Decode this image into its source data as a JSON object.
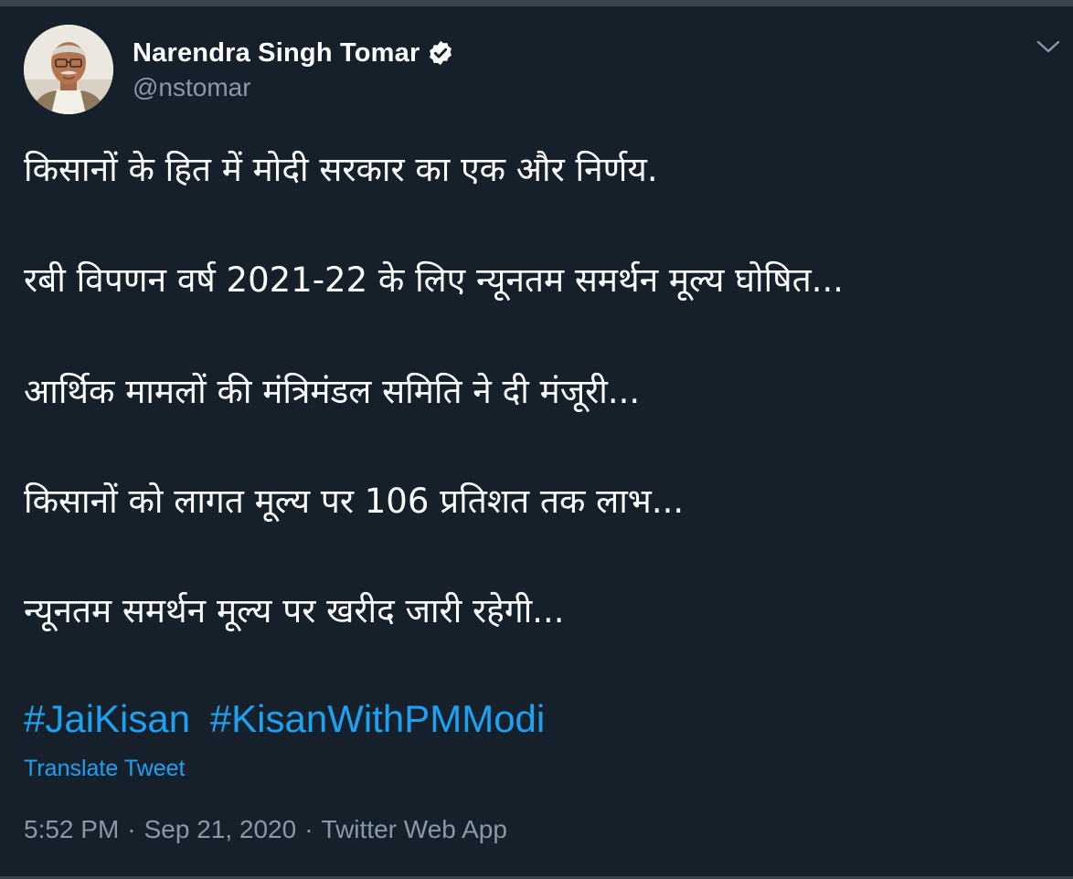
{
  "author": {
    "name": "Narendra Singh Tomar",
    "handle": "@nstomar",
    "verified": true
  },
  "tweet": {
    "lines": [
      "किसानों के हित में मोदी सरकार का एक और निर्णय.",
      "रबी विपणन वर्ष 2021-22 के लिए न्यूनतम समर्थन मूल्य घोषित...",
      "आर्थिक मामलों की मंत्रिमंडल समिति ने दी मंजूरी...",
      "किसानों को लागत मूल्य पर 106 प्रतिशत तक लाभ...",
      "न्यूनतम समर्थन मूल्य पर खरीद जारी रहेगी..."
    ],
    "hashtags": [
      "#JaiKisan",
      "#KisanWithPMModi"
    ],
    "translate_label": "Translate Tweet"
  },
  "meta": {
    "time": "5:52 PM",
    "separator": "·",
    "date": "Sep 21, 2020",
    "source": "Twitter Web App"
  },
  "icons": {
    "verified": "verified-badge-icon",
    "menu": "chevron-down-icon"
  },
  "colors": {
    "background": "#15202b",
    "link": "#1da1f2",
    "secondary_text": "#8899a6",
    "primary_text": "#ffffff"
  }
}
